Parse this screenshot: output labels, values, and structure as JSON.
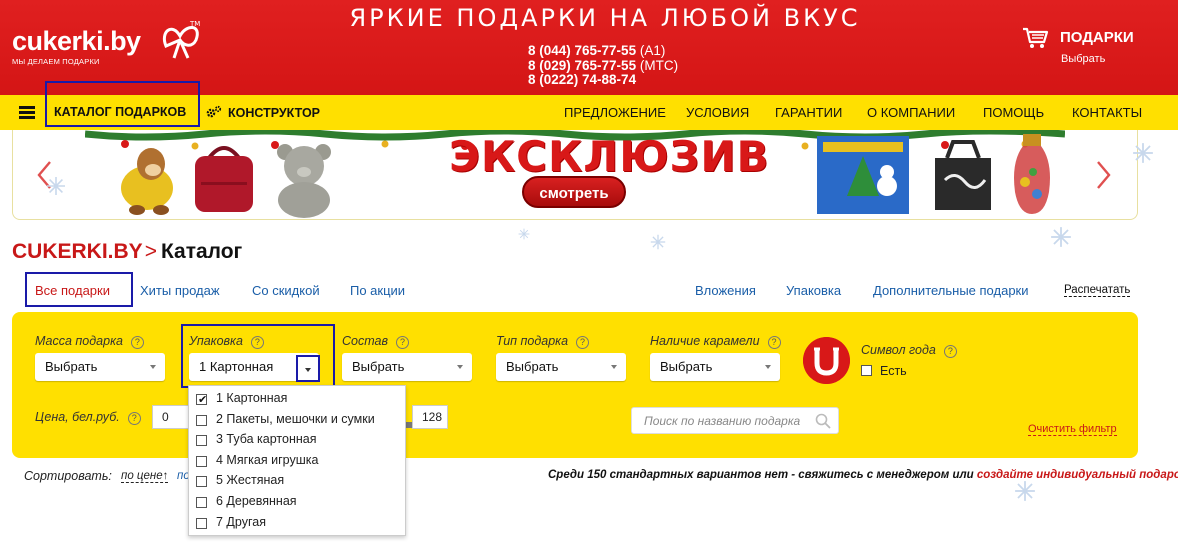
{
  "header": {
    "logo_text": "cukerki.by",
    "logo_tm": "TM",
    "logo_tagline": "МЫ ДЕЛАЕМ ПОДАРКИ",
    "slogan": "ЯРКИЕ ПОДАРКИ НА ЛЮБОЙ ВКУС",
    "phones": [
      {
        "number": "8 (044) 765-77-55",
        "operator": "(A1)"
      },
      {
        "number": "8 (029) 765-77-55",
        "operator": "(МТС)"
      },
      {
        "number": "8 (0222) 74-88-74",
        "operator": ""
      }
    ],
    "cart_title": "ПОДАРКИ",
    "cart_sub": "Выбрать",
    "cart_icon": "cart-icon"
  },
  "nav": {
    "catalog": "КАТАЛОГ ПОДАРКОВ",
    "constructor": "КОНСТРУКТОР",
    "items": [
      "ПРЕДЛОЖЕНИЕ",
      "УСЛОВИЯ",
      "ГАРАНТИИ",
      "О КОМПАНИИ",
      "ПОМОЩЬ",
      "КОНТАКТЫ"
    ]
  },
  "banner": {
    "title": "ЭКСКЛЮЗИВ",
    "button": "смотреть"
  },
  "breadcrumb": {
    "site": "CUKERKI.BY",
    "current": "Каталог"
  },
  "tabs": {
    "left": [
      "Все подарки",
      "Хиты продаж",
      "Со скидкой",
      "По акции"
    ],
    "right": [
      "Вложения",
      "Упаковка",
      "Дополнительные подарки"
    ],
    "print": "Распечатать"
  },
  "filters": {
    "mass_label": "Масса подарка",
    "mass_value": "Выбрать",
    "packaging_label": "Упаковка",
    "packaging_value": "1 Картонная",
    "composition_label": "Состав",
    "composition_value": "Выбрать",
    "type_label": "Тип подарка",
    "type_value": "Выбрать",
    "caramel_label": "Наличие карамели",
    "caramel_value": "Выбрать",
    "year_symbol_label": "Символ года",
    "year_symbol_option": "Есть",
    "help_glyph": "?",
    "price_label": "Цена, бел.руб.",
    "price_min": "0",
    "price_max": "128",
    "search_placeholder": "Поиск по названию подарка",
    "clear": "Очистить фильтр"
  },
  "packaging_options": [
    {
      "label": "1 Картонная",
      "checked": true
    },
    {
      "label": "2 Пакеты, мешочки и сумки",
      "checked": false
    },
    {
      "label": "3 Туба картонная",
      "checked": false
    },
    {
      "label": "4 Мягкая игрушка",
      "checked": false
    },
    {
      "label": "5 Жестяная",
      "checked": false
    },
    {
      "label": "6 Деревянная",
      "checked": false
    },
    {
      "label": "7 Другая",
      "checked": false
    }
  ],
  "sort": {
    "label": "Сортировать:",
    "by_price": "по цене↑",
    "by_other": "по",
    "notice_text": "Среди 150 стандартных вариантов нет - свяжитесь с менеджером или ",
    "notice_link": "создайте индивидуальный подарок"
  },
  "colors": {
    "header_red": "#d41515",
    "nav_yellow": "#ffe000",
    "link_blue": "#1a5ea8",
    "highlight_box": "#1a1aa8"
  }
}
